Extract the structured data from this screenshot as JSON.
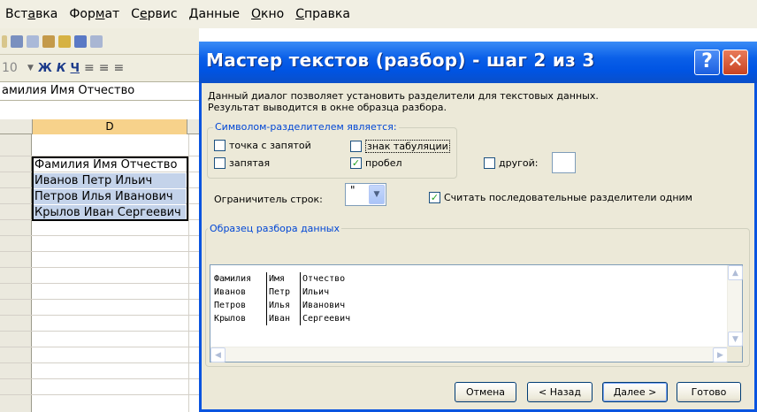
{
  "excel": {
    "menu": [
      {
        "pre": "Вст",
        "u": "а",
        "post": "вка"
      },
      {
        "pre": "Фор",
        "u": "м",
        "post": "ат"
      },
      {
        "pre": "С",
        "u": "е",
        "post": "рвис"
      },
      {
        "pre": "",
        "u": "Д",
        "post": "анные"
      },
      {
        "pre": "",
        "u": "О",
        "post": "кно"
      },
      {
        "pre": "",
        "u": "С",
        "post": "правка"
      }
    ],
    "font_size": "10",
    "formula_text": "амилия Имя Отчество",
    "column_header": "D",
    "cells": [
      "Фамилия Имя Отчество",
      "Иванов Петр Ильич",
      "Петров Илья Иванович",
      "Крылов Иван Сергеевич"
    ]
  },
  "dialog": {
    "title": "Мастер текстов (разбор) - шаг 2 из 3",
    "help_label": "?",
    "close_label": "✕",
    "description_line1": "Данный диалог позволяет установить разделители для текстовых данных.",
    "description_line2": "Результат выводится в окне образца разбора.",
    "delimiters_legend": "Символом-разделителем является:",
    "delimiters": {
      "semicolon": {
        "label": "точка с запятой",
        "checked": false
      },
      "tab": {
        "label": "знак табуляции",
        "checked": false
      },
      "other": {
        "label": "другой:",
        "checked": false,
        "value": ""
      },
      "comma": {
        "label": "запятая",
        "checked": false
      },
      "space": {
        "label": "пробел",
        "checked": true
      }
    },
    "check_mark": "✓",
    "qualifier_label": "Ограничитель строк:",
    "qualifier_value": "\"",
    "consecutive_label": "Считать последовательные разделители одним",
    "consecutive_checked": true,
    "preview_legend": "Образец разбора данных",
    "preview_rows": [
      [
        "Фамилия",
        "Имя",
        "Отчество"
      ],
      [
        "Иванов",
        "Петр",
        "Ильич"
      ],
      [
        "Петров",
        "Илья",
        "Иванович"
      ],
      [
        "Крылов",
        "Иван",
        "Сергеевич"
      ]
    ],
    "buttons": {
      "cancel": "Отмена",
      "back": "< Назад",
      "next": "Далее >",
      "finish": "Готово"
    }
  }
}
